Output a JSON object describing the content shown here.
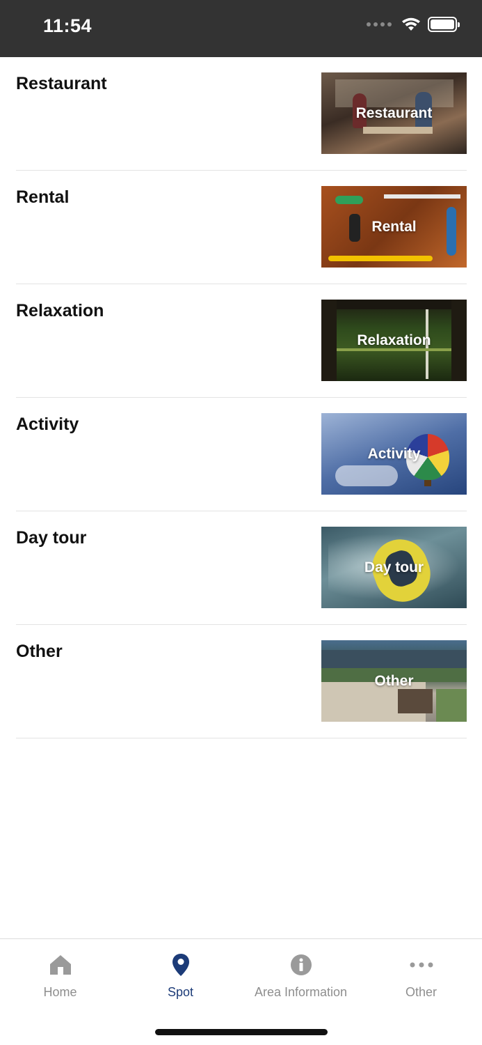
{
  "status_bar": {
    "time": "11:54"
  },
  "categories": [
    {
      "title": "Restaurant",
      "image_label": "Restaurant"
    },
    {
      "title": "Rental",
      "image_label": "Rental"
    },
    {
      "title": "Relaxation",
      "image_label": "Relaxation"
    },
    {
      "title": "Activity",
      "image_label": "Activity"
    },
    {
      "title": "Day tour",
      "image_label": "Day tour"
    },
    {
      "title": "Other",
      "image_label": "Other"
    }
  ],
  "tab_bar": {
    "items": [
      {
        "label": "Home",
        "icon": "home-icon"
      },
      {
        "label": "Spot",
        "icon": "map-pin-icon",
        "active": true
      },
      {
        "label": "Area Information",
        "icon": "info-icon"
      },
      {
        "label": "Other",
        "icon": "more-icon"
      }
    ],
    "active_color": "#1c3b78",
    "inactive_color": "#8e8e8e"
  }
}
